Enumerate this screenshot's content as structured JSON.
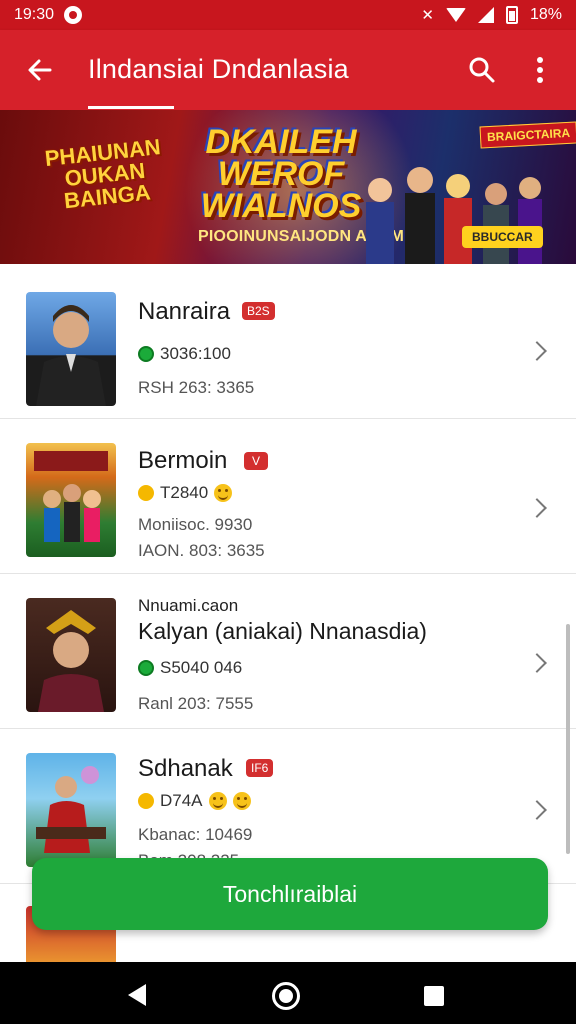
{
  "status_bar": {
    "time": "19:30",
    "battery_text": "18%"
  },
  "app_bar": {
    "title": "Ilndansiai Dndanlasia",
    "back_icon": "arrow-left-icon",
    "search_icon": "search-icon",
    "more_icon": "more-vert-icon"
  },
  "banner": {
    "left_text": "PHAIUNAN OUKAN BAINGA",
    "logo_text": "DKAILEH WEROF WIALNOS",
    "caption": "PIOOINUNSAIJODN ANAM",
    "tag": "BRAIGCTAIRA",
    "cta": "BBUCCAR"
  },
  "list": {
    "items": [
      {
        "title": "Nanraira",
        "badge": "B2S",
        "stat": "3036:100",
        "lines": [
          "RSH 263: 3365"
        ],
        "subtitle": "",
        "accent": "#1bab3a"
      },
      {
        "title": "Bermoin",
        "badge": "V",
        "stat": "T2840",
        "lines": [
          "Moniisoc. 9930",
          "IAON. 803: 3635"
        ],
        "subtitle": "",
        "accent": "#f5b800"
      },
      {
        "title": "Kalyan (aniakai) Nnanasdia)",
        "badge": "",
        "stat": "S5040  046",
        "lines": [
          "Ranl 203: 7555"
        ],
        "subtitle": "Nnuami.caon",
        "accent": "#1bab3a"
      },
      {
        "title": "Sdhanak",
        "badge": "IF6",
        "stat": "D74A",
        "lines": [
          "Kbanac: 10469",
          "Bom 208 225"
        ],
        "subtitle": "",
        "accent": "#f5b800"
      }
    ]
  },
  "cta_button": {
    "label": "Tonchlıraiblai"
  },
  "colors": {
    "primary": "#d6212a",
    "status": "#c8161e",
    "cta": "#1ea83c"
  }
}
